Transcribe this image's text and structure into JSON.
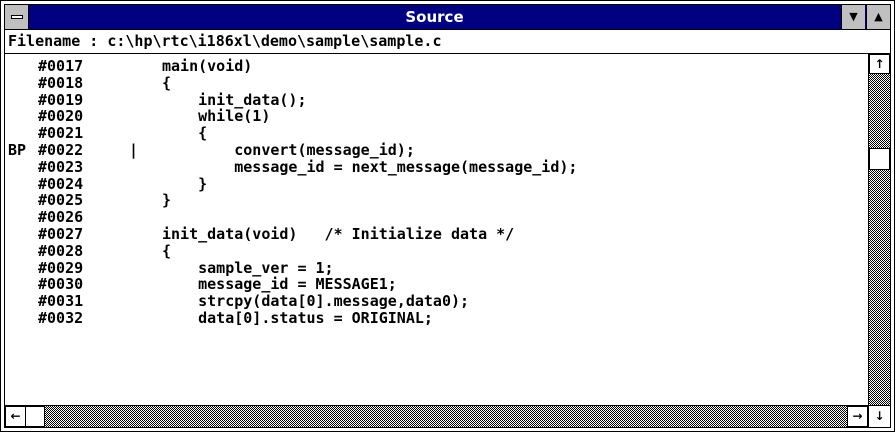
{
  "window": {
    "title": "Source",
    "system_menu_icon": "system-menu-icon",
    "minimize_icon": "triangle-down",
    "maximize_icon": "triangle-up"
  },
  "filebar": {
    "text": "Filename : c:\\hp\\rtc\\i186xl\\demo\\sample\\sample.c"
  },
  "code": {
    "lines": [
      {
        "bp": "",
        "num": "#0017",
        "cursor": "",
        "text": "main(void)"
      },
      {
        "bp": "",
        "num": "#0018",
        "cursor": "",
        "text": "{"
      },
      {
        "bp": "",
        "num": "#0019",
        "cursor": "",
        "text": "    init_data();"
      },
      {
        "bp": "",
        "num": "#0020",
        "cursor": "",
        "text": "    while(1)"
      },
      {
        "bp": "",
        "num": "#0021",
        "cursor": "",
        "text": "    {"
      },
      {
        "bp": "BP",
        "num": "#0022",
        "cursor": "|",
        "text": "        convert(message_id);"
      },
      {
        "bp": "",
        "num": "#0023",
        "cursor": "",
        "text": "        message_id = next_message(message_id);"
      },
      {
        "bp": "",
        "num": "#0024",
        "cursor": "",
        "text": "    }"
      },
      {
        "bp": "",
        "num": "#0025",
        "cursor": "",
        "text": "}"
      },
      {
        "bp": "",
        "num": "#0026",
        "cursor": "",
        "text": ""
      },
      {
        "bp": "",
        "num": "#0027",
        "cursor": "",
        "text": "init_data(void)   /* Initialize data */"
      },
      {
        "bp": "",
        "num": "#0028",
        "cursor": "",
        "text": "{"
      },
      {
        "bp": "",
        "num": "#0029",
        "cursor": "",
        "text": "    sample_ver = 1;"
      },
      {
        "bp": "",
        "num": "#0030",
        "cursor": "",
        "text": "    message_id = MESSAGE1;"
      },
      {
        "bp": "",
        "num": "#0031",
        "cursor": "",
        "text": "    strcpy(data[0].message,data0);"
      },
      {
        "bp": "",
        "num": "#0032",
        "cursor": "",
        "text": "    data[0].status = ORIGINAL;"
      }
    ]
  },
  "scrollbars": {
    "up_glyph": "↑",
    "left_glyph": "←",
    "right_glyph": "→",
    "down_glyph": "↓"
  },
  "colors": {
    "titlebar": "#000080",
    "title_text": "#ffffff",
    "buttons": "#c0c0c0"
  }
}
